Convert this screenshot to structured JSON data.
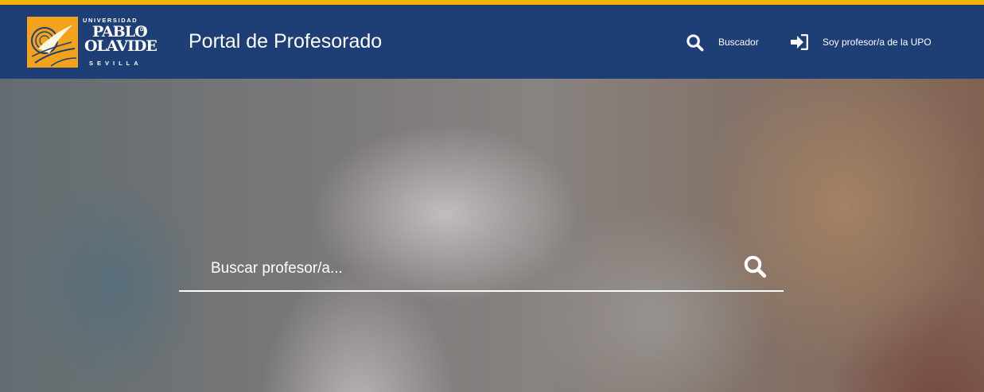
{
  "header": {
    "logo": {
      "line_top": "UNIVERSIDAD",
      "line1": "PABLO",
      "de": "DE",
      "line2": "OLAVIDE",
      "line_bottom": "SEVILLA"
    },
    "title": "Portal de Profesorado",
    "nav": {
      "search_label": "Buscador",
      "login_label": "Soy profesor/a de la UPO"
    }
  },
  "hero": {
    "search": {
      "placeholder": "Buscar profesor/a...",
      "value": ""
    }
  },
  "colors": {
    "accent": "#f5b400",
    "header_bg": "#1e3e76",
    "logo_mark": "#f3a31b"
  },
  "icons": {
    "nav_search": "search-icon",
    "nav_login": "sign-in-icon",
    "hero_search": "search-icon"
  }
}
